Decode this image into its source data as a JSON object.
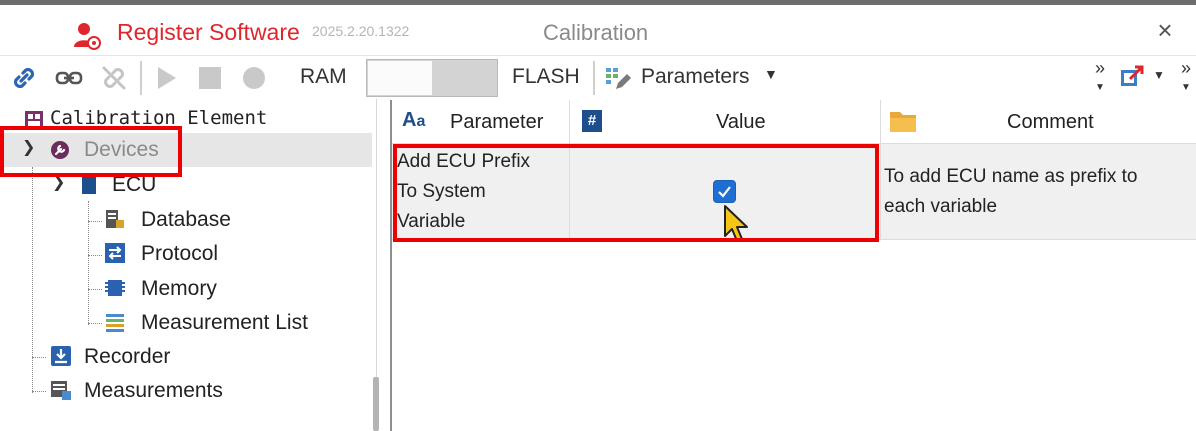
{
  "titlebar": {
    "app_name": "Register Software",
    "version": "2025.2.20.1322",
    "window_title": "Calibration",
    "close": "×"
  },
  "toolbar": {
    "ram_label": "RAM",
    "flash_label": "FLASH",
    "parameters_label": "Parameters",
    "ram_flash_toggle": "RAM"
  },
  "tree": {
    "header": "Calibration Element",
    "items": [
      {
        "label": "Devices",
        "expanded": true,
        "selected": true
      },
      {
        "label": "ECU",
        "expanded": true
      },
      {
        "label": "Database"
      },
      {
        "label": "Protocol"
      },
      {
        "label": "Memory"
      },
      {
        "label": "Measurement List"
      },
      {
        "label": "Recorder"
      },
      {
        "label": "Measurements"
      }
    ]
  },
  "grid": {
    "columns": [
      {
        "label": "Parameter",
        "icon": "text-aa-icon"
      },
      {
        "label": "Value",
        "icon": "hash-icon"
      },
      {
        "label": "Comment",
        "icon": "folder-icon"
      }
    ],
    "rows": [
      {
        "parameter": "Add ECU Prefix\nTo System\nVariable",
        "value_checked": true,
        "comment": "To add ECU name as prefix to\neach variable"
      }
    ]
  },
  "colors": {
    "brand_red": "#e0262d",
    "highlight_red": "#ee0000",
    "checkbox_blue": "#1e6fd1",
    "cursor_yellow": "#f5c518"
  }
}
